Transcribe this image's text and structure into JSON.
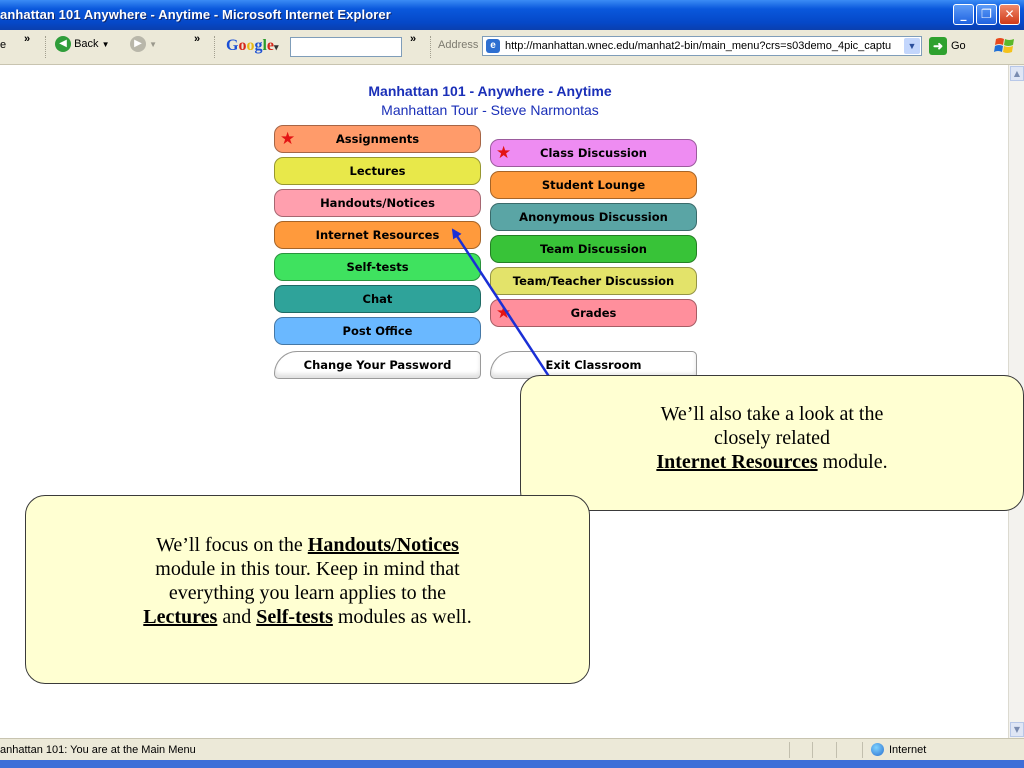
{
  "window": {
    "title": "anhattan 101 Anywhere - Anytime - Microsoft Internet Explorer",
    "controls": {
      "minimize": "_",
      "maximize": "❐",
      "close": "✕"
    }
  },
  "toolbar": {
    "cut_label": "e",
    "chevron": "»",
    "back_label": "Back",
    "google_logo": "Google",
    "google_query": "",
    "address_label": "Address",
    "url": "http://manhattan.wnec.edu/manhat2-bin/main_menu?crs=s03demo_4pic_captu",
    "go_label": "Go"
  },
  "page": {
    "title": "Manhattan 101 - Anywhere - Anytime",
    "subtitle": "Manhattan Tour - Steve Narmontas"
  },
  "menu_left": [
    {
      "label": "Assignments",
      "color": "#ff9b6a",
      "star": true
    },
    {
      "label": "Lectures",
      "color": "#e8e84a",
      "star": false
    },
    {
      "label": "Handouts/Notices",
      "color": "#ff9fae",
      "star": false
    },
    {
      "label": "Internet Resources",
      "color": "#ff9a3c",
      "star": false
    },
    {
      "label": "Self-tests",
      "color": "#3fe25f",
      "star": false
    },
    {
      "label": "Chat",
      "color": "#2fa39a",
      "star": false
    },
    {
      "label": "Post Office",
      "color": "#6ab8ff",
      "star": false
    }
  ],
  "menu_right": [
    {
      "label": "Class Discussion",
      "color": "#ee8cf2",
      "star": true
    },
    {
      "label": "Student Lounge",
      "color": "#ff9a3c",
      "star": false
    },
    {
      "label": "Anonymous Discussion",
      "color": "#5aa5a5",
      "star": false
    },
    {
      "label": "Team Discussion",
      "color": "#38c338",
      "star": false
    },
    {
      "label": "Team/Teacher Discussion",
      "color": "#e3e36a",
      "star": false
    },
    {
      "label": "Grades",
      "color": "#ff8f9c",
      "star": true
    }
  ],
  "bottom_buttons": {
    "change_password": "Change Your Password",
    "exit": "Exit Classroom"
  },
  "callout_resources": {
    "line1": "We’ll also take a look at the",
    "line2": "closely related",
    "bold": "Internet Resources",
    "tail": " module."
  },
  "callout_handouts": {
    "line1_pre": "We’ll focus on the ",
    "line1_bold": "Handouts/Notices",
    "line2": "module in this tour.  Keep in mind that",
    "line3": "everything you learn applies to the",
    "line4_bold1": "Lectures",
    "line4_mid": " and ",
    "line4_bold2": "Self-tests",
    "line4_tail": " modules as well."
  },
  "statusbar": {
    "text": "anhattan 101: You are at the Main Menu",
    "zone": "Internet"
  },
  "icons": {
    "back": "back-arrow-icon",
    "forward": "forward-arrow-icon",
    "go": "go-arrow-icon",
    "star": "star-icon",
    "zone": "globe-icon"
  }
}
